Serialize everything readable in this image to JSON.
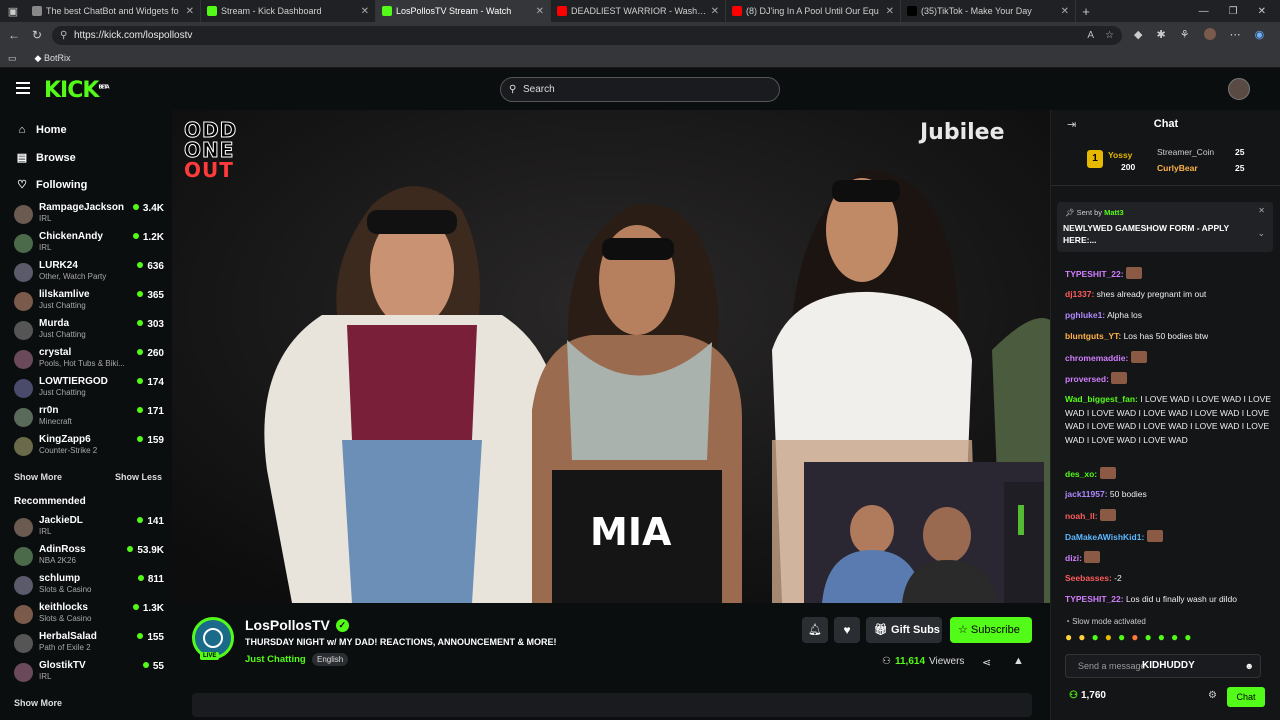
{
  "browser": {
    "tabs": [
      {
        "title": "The best ChatBot and Widgets fo",
        "color": "#888"
      },
      {
        "title": "Stream - Kick Dashboard",
        "color": "#53fc18"
      },
      {
        "title": "LosPollosTV Stream - Watch",
        "color": "#53fc18",
        "active": true
      },
      {
        "title": "DEADLIEST WARRIOR - Washingt",
        "color": "#ff0000"
      },
      {
        "title": "(8) DJ'ing In A Pool Until Our Equ",
        "color": "#ff0000"
      },
      {
        "title": "(35)TikTok - Make Your Day",
        "color": "#000"
      }
    ],
    "url": "https://kick.com/lospollostv",
    "bookmark": "BotRix"
  },
  "header": {
    "logo": "KICK",
    "logo_beta": "BETA",
    "search_placeholder": "Search"
  },
  "sidebar": {
    "nav": [
      {
        "label": "Home",
        "icon": "home-icon"
      },
      {
        "label": "Browse",
        "icon": "browse-icon"
      },
      {
        "label": "Following",
        "icon": "heart-icon"
      }
    ],
    "following": [
      {
        "name": "RampageJackson",
        "sub": "IRL",
        "viewers": "3.4K"
      },
      {
        "name": "ChickenAndy",
        "sub": "IRL",
        "viewers": "1.2K"
      },
      {
        "name": "LURK24",
        "sub": "Other, Watch Party",
        "viewers": "636"
      },
      {
        "name": "lilskamlive",
        "sub": "Just Chatting",
        "viewers": "365"
      },
      {
        "name": "Murda",
        "sub": "Just Chatting",
        "viewers": "303"
      },
      {
        "name": "crystal",
        "sub": "Pools, Hot Tubs & Biki...",
        "viewers": "260"
      },
      {
        "name": "LOWTIERGOD",
        "sub": "Just Chatting",
        "viewers": "174"
      },
      {
        "name": "rr0n",
        "sub": "Minecraft",
        "viewers": "171"
      },
      {
        "name": "KingZapp6",
        "sub": "Counter-Strike 2",
        "viewers": "159"
      }
    ],
    "show_more": "Show More",
    "show_less": "Show Less",
    "recommended_title": "Recommended",
    "recommended": [
      {
        "name": "JackieDL",
        "sub": "IRL",
        "viewers": "141"
      },
      {
        "name": "AdinRoss",
        "sub": "NBA 2K26",
        "viewers": "53.9K"
      },
      {
        "name": "schlump",
        "sub": "Slots & Casino",
        "viewers": "811"
      },
      {
        "name": "keithlocks",
        "sub": "Slots & Casino",
        "viewers": "1.3K"
      },
      {
        "name": "HerbalSalad",
        "sub": "Path of Exile 2",
        "viewers": "155"
      },
      {
        "name": "GlostikTV",
        "sub": "IRL",
        "viewers": "55"
      }
    ],
    "show_more_2": "Show More"
  },
  "video": {
    "show_logo_lines": [
      "ODD",
      "ONE",
      "OUT"
    ],
    "brand": "Jubilee",
    "caption": "MIA"
  },
  "channel": {
    "name": "LosPollosTV",
    "live_badge": "LIVE",
    "title": "THURSDAY NIGHT w/ MY DAD! REACTIONS, ANNOUNCEMENT & MORE!",
    "category": "Just Chatting",
    "language": "English",
    "viewers": "11,614",
    "viewers_label": "Viewers",
    "gift_label": "Gift Subs",
    "subscribe_label": "Subscribe"
  },
  "chat": {
    "title": "Chat",
    "leaderboard": [
      {
        "rank": "1",
        "name": "Yossy",
        "value": "200"
      },
      {
        "name": "Streamer_Coin",
        "value": "25"
      },
      {
        "name": "CurlyBear",
        "value": "25"
      }
    ],
    "pinned_by_label": "Sent by",
    "pinned_by": "Matt3",
    "pinned_text": "NEWLYWED GAMESHOW FORM - APPLY HERE:...",
    "messages": [
      {
        "user": "TYPESHIT_22:",
        "text": "",
        "color": "#d17fff"
      },
      {
        "user": "dj1337:",
        "text": "shes already pregnant im out",
        "color": "#ff5c5c"
      },
      {
        "user": "pghluke1:",
        "text": "Alpha los",
        "color": "#b089ff"
      },
      {
        "user": "bluntguts_YT:",
        "text": "Los has 50 bodies btw",
        "color": "#ffb347"
      },
      {
        "user": "chromemaddie:",
        "text": "",
        "color": "#d17fff"
      },
      {
        "user": "proversed:",
        "text": "",
        "color": "#d17fff"
      },
      {
        "user": "Wad_biggest_fan:",
        "text": "I LOVE WAD I LOVE WAD I LOVE WAD I LOVE WAD I LOVE WAD I LOVE WAD I LOVE WAD I LOVE WAD I LOVE WAD I LOVE WAD I LOVE WAD I LOVE WAD I LOVE WAD",
        "color": "#53fc18"
      },
      {
        "user": "des_xo:",
        "text": "",
        "color": "#53fc18"
      },
      {
        "user": "jack11957:",
        "text": "50 bodies",
        "color": "#b089ff"
      },
      {
        "user": "noah_ll:",
        "text": "",
        "color": "#ff5c5c"
      },
      {
        "user": "DaMakeAWishKid1:",
        "text": "",
        "color": "#5cb8ff"
      },
      {
        "user": "dizi:",
        "text": "",
        "color": "#d17fff"
      },
      {
        "user": "Seebasses:",
        "text": "-2",
        "color": "#ff5c5c"
      },
      {
        "user": "TYPESHIT_22:",
        "text": "Los did u finally wash ur dildo",
        "color": "#d17fff"
      }
    ],
    "slow_mode": "Slow mode activated",
    "input_placeholder": "Send a message",
    "overlay_name": "KIDHUDDY",
    "points": "1,760",
    "send_label": "Chat"
  }
}
